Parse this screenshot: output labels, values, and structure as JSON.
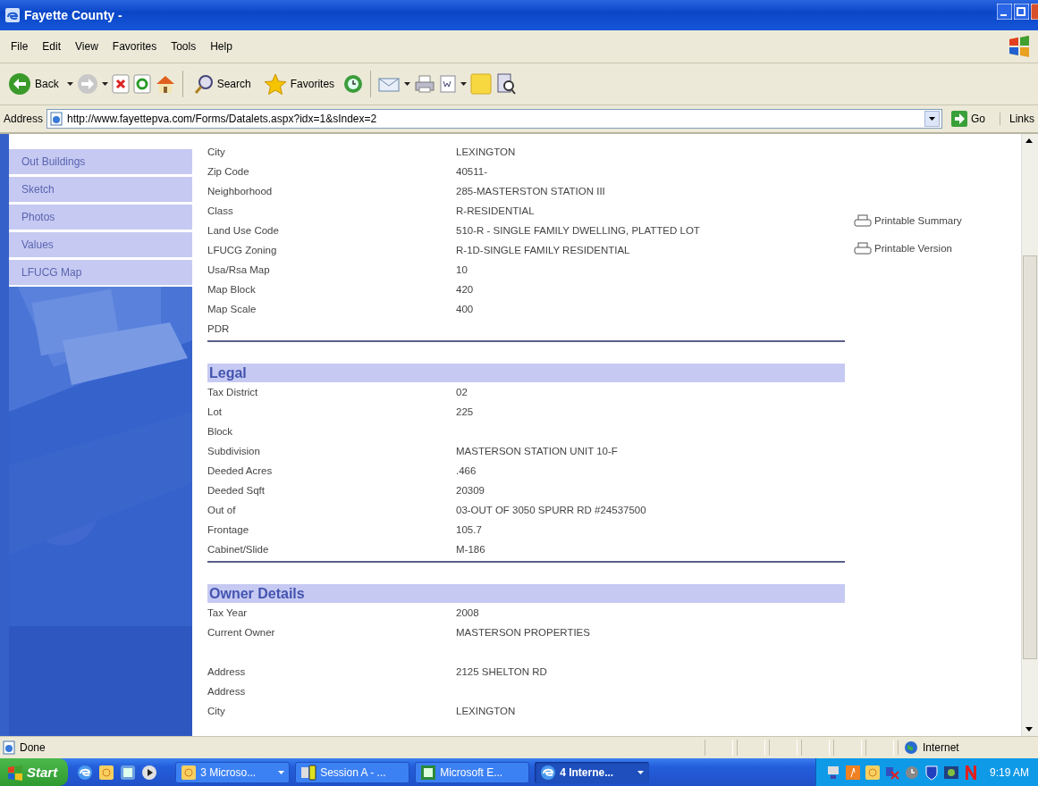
{
  "window": {
    "title": "Fayette County -"
  },
  "menu": [
    "File",
    "Edit",
    "View",
    "Favorites",
    "Tools",
    "Help"
  ],
  "toolbar": [
    {
      "kind": "back",
      "label": "Back",
      "dropdown": true
    },
    {
      "kind": "forward",
      "dropdown": true
    },
    {
      "kind": "stop"
    },
    {
      "kind": "refresh"
    },
    {
      "kind": "home"
    },
    {
      "kind": "search",
      "label": "Search"
    },
    {
      "kind": "favorites",
      "label": "Favorites"
    },
    {
      "kind": "history"
    },
    {
      "kind": "mail",
      "dropdown": true
    },
    {
      "kind": "print"
    },
    {
      "kind": "edit",
      "dropdown": true
    },
    {
      "kind": "note"
    },
    {
      "kind": "research"
    }
  ],
  "address": {
    "label": "Address",
    "value": "http://www.fayettepva.com/Forms/Datalets.aspx?idx=1&sIndex=2",
    "go": "Go",
    "links": "Links"
  },
  "sidebar": {
    "items": [
      "Out Buildings",
      "Sketch",
      "Photos",
      "Values",
      "LFUCG Map"
    ]
  },
  "sections": [
    {
      "rows": [
        {
          "kind": "field",
          "label": "City",
          "value": "LEXINGTON"
        },
        {
          "kind": "field",
          "label": "Zip Code",
          "value": "40511-"
        },
        {
          "kind": "field",
          "label": "Neighborhood",
          "value": "285-MASTERSTON STATION III"
        },
        {
          "kind": "field",
          "label": "Class",
          "value": "R-RESIDENTIAL"
        },
        {
          "kind": "field",
          "label": "Land Use Code",
          "value": "510-R - SINGLE FAMILY DWELLING, PLATTED LOT"
        },
        {
          "kind": "field",
          "label": "LFUCG Zoning",
          "value": "R-1D-SINGLE FAMILY RESIDENTIAL"
        },
        {
          "kind": "field",
          "label": "Usa/Rsa Map",
          "value": "10"
        },
        {
          "kind": "field",
          "label": "Map Block",
          "value": "420"
        },
        {
          "kind": "field",
          "label": "Map Scale",
          "value": "400"
        },
        {
          "kind": "field",
          "label": "PDR"
        }
      ]
    },
    {
      "title": "Legal",
      "rows": [
        {
          "kind": "field",
          "label": "Tax District",
          "value": "02"
        },
        {
          "kind": "field",
          "label": "Lot",
          "value": "225"
        },
        {
          "kind": "field",
          "label": "Block"
        },
        {
          "kind": "field",
          "label": "Subdivision",
          "value": "MASTERSON STATION UNIT 10-F"
        },
        {
          "kind": "field",
          "label": "Deeded Acres",
          "value": ".466"
        },
        {
          "kind": "field",
          "label": "Deeded Sqft",
          "value": "20309"
        },
        {
          "kind": "field",
          "label": "Out of",
          "value": "03-OUT OF 3050 SPURR RD #24537500"
        },
        {
          "kind": "field",
          "label": "Frontage",
          "value": "105.7"
        },
        {
          "kind": "field",
          "label": "Cabinet/Slide",
          "value": "M-186"
        }
      ]
    },
    {
      "title": "Owner Details",
      "rows": [
        {
          "kind": "field",
          "label": "Tax Year",
          "value": "2008"
        },
        {
          "kind": "field",
          "label": "Current Owner",
          "value": "MASTERSON PROPERTIES"
        },
        {
          "kind": "blank"
        },
        {
          "kind": "field",
          "label": "Address",
          "value": "2125 SHELTON RD"
        },
        {
          "kind": "field",
          "label": "Address"
        },
        {
          "kind": "field",
          "label": "City",
          "value": "LEXINGTON"
        }
      ]
    }
  ],
  "side_links": [
    "Printable Summary",
    "Printable Version"
  ],
  "status_bar": {
    "text": "Done",
    "zone": "Internet"
  },
  "taskbar": {
    "start": "Start",
    "tasks": [
      {
        "kind": "folder",
        "label": "3 Microso...",
        "selected": false,
        "dropdown": true
      },
      {
        "kind": "session",
        "label": "Session A - ...",
        "selected": false
      },
      {
        "kind": "excel",
        "label": "Microsoft E...",
        "selected": false
      },
      {
        "kind": "ie",
        "label": "4 Interne...",
        "selected": true,
        "dropdown": true
      }
    ],
    "clock": "9:19 AM"
  }
}
